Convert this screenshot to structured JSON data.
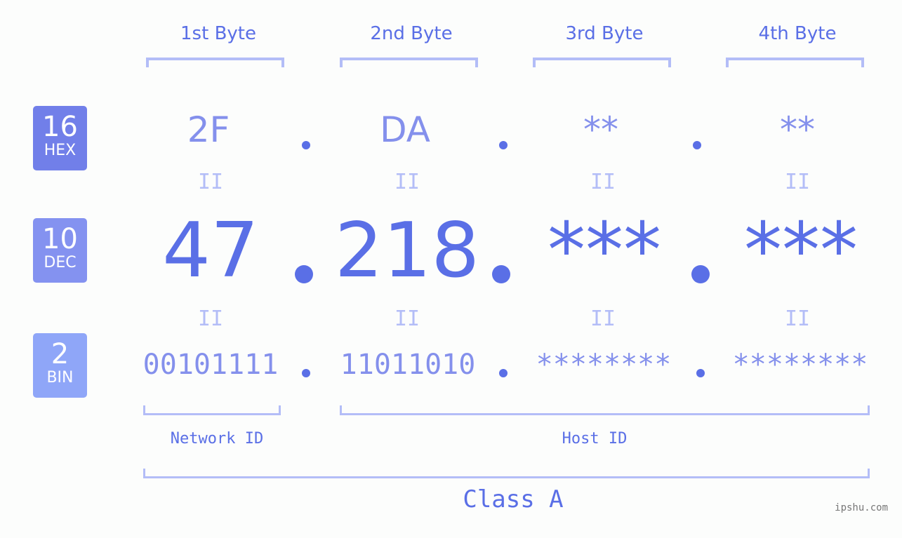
{
  "bases": [
    {
      "num": "16",
      "label": "HEX",
      "color": "#717fe9"
    },
    {
      "num": "10",
      "label": "DEC",
      "color": "#8492f0"
    },
    {
      "num": "2",
      "label": "BIN",
      "color": "#8fa6f8"
    }
  ],
  "byte_headers": [
    "1st Byte",
    "2nd Byte",
    "3rd Byte",
    "4th Byte"
  ],
  "hex": [
    "2F",
    "DA",
    "**",
    "**"
  ],
  "dec": [
    "47",
    "218",
    "***",
    "***"
  ],
  "bin": [
    "00101111",
    "11011010",
    "********",
    "********"
  ],
  "equals_symbol": "II",
  "network_id_label": "Network ID",
  "host_id_label": "Host ID",
  "class_label": "Class A",
  "watermark": "ipshu.com",
  "colors": {
    "accent": "#5a6fe6",
    "light_accent": "#8490ec",
    "bracket": "#b3bdf7",
    "background": "#fcfdfc"
  }
}
